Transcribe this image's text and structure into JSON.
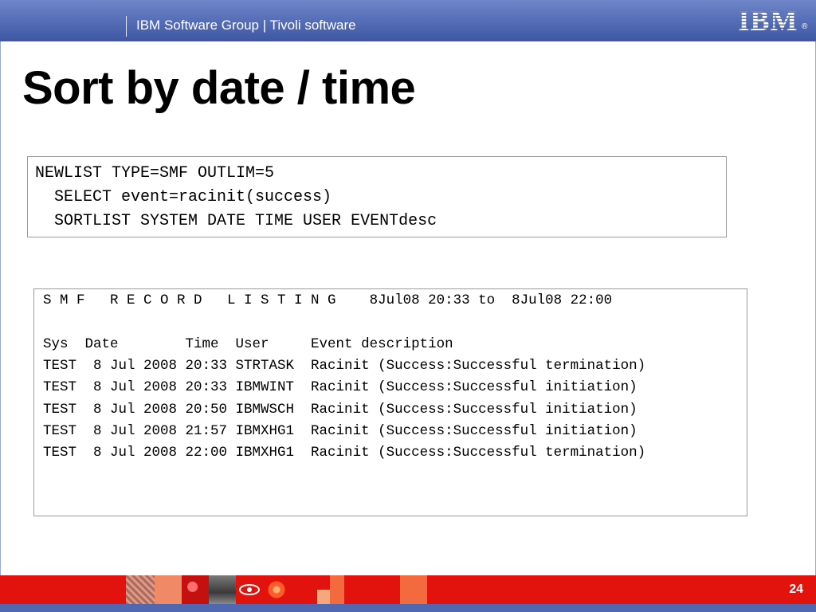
{
  "header": {
    "group": "IBM Software Group | Tivoli software",
    "logo_text": "IBM",
    "registered": "®"
  },
  "title": "Sort by date / time",
  "command": {
    "lines": [
      "NEWLIST TYPE=SMF OUTLIM=5",
      "  SELECT event=racinit(success)",
      "  SORTLIST SYSTEM DATE TIME USER EVENTdesc"
    ]
  },
  "listing": {
    "heading": "S M F   R E C O R D   L I S T I N G    8Jul08 20:33 to  8Jul08 22:00",
    "columns": "Sys  Date        Time  User     Event description",
    "rows": [
      "TEST  8 Jul 2008 20:33 STRTASK  Racinit (Success:Successful termination)",
      "TEST  8 Jul 2008 20:33 IBMWINT  Racinit (Success:Successful initiation)",
      "TEST  8 Jul 2008 20:50 IBMWSCH  Racinit (Success:Successful initiation)",
      "TEST  8 Jul 2008 21:57 IBMXHG1  Racinit (Success:Successful initiation)",
      "TEST  8 Jul 2008 22:00 IBMXHG1  Racinit (Success:Successful termination)"
    ]
  },
  "footer": {
    "page_number": "24"
  },
  "colors": {
    "header_blue": "#5870b9",
    "footer_red": "#e2120c",
    "footer_blue": "#4f68b1"
  }
}
